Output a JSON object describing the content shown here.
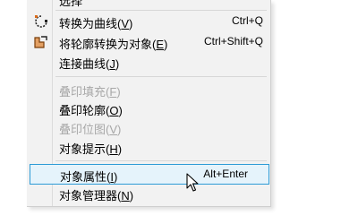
{
  "menu": {
    "partial_top_label": "选择",
    "items": [
      {
        "label": "转换为曲线",
        "mnemonic": "V",
        "shortcut": "Ctrl+Q",
        "icon": "convert-to-curves-icon",
        "disabled": false
      },
      {
        "label": "将轮廓转换为对象",
        "mnemonic": "E",
        "shortcut": "Ctrl+Shift+Q",
        "icon": "outline-to-object-icon",
        "disabled": false
      },
      {
        "label": "连接曲线",
        "mnemonic": "J",
        "shortcut": "",
        "icon": "",
        "disabled": false
      },
      {
        "label": "叠印填充",
        "mnemonic": "F",
        "shortcut": "",
        "icon": "",
        "disabled": true
      },
      {
        "label": "叠印轮廓",
        "mnemonic": "O",
        "shortcut": "",
        "icon": "",
        "disabled": false
      },
      {
        "label": "叠印位图",
        "mnemonic": "V",
        "shortcut": "",
        "icon": "",
        "disabled": true
      },
      {
        "label": "对象提示",
        "mnemonic": "H",
        "shortcut": "",
        "icon": "",
        "disabled": false
      },
      {
        "label": "对象属性",
        "mnemonic": "I",
        "shortcut": "Alt+Enter",
        "icon": "",
        "disabled": false,
        "highlighted": true
      },
      {
        "label": "对象管理器",
        "mnemonic": "N",
        "shortcut": "",
        "icon": "",
        "disabled": false
      }
    ]
  },
  "colors": {
    "menu_bg": "#f2f2f2",
    "highlight_bg": "#e5f3fb",
    "highlight_border": "#2d9bd6",
    "disabled_text": "#a8a8a8"
  }
}
